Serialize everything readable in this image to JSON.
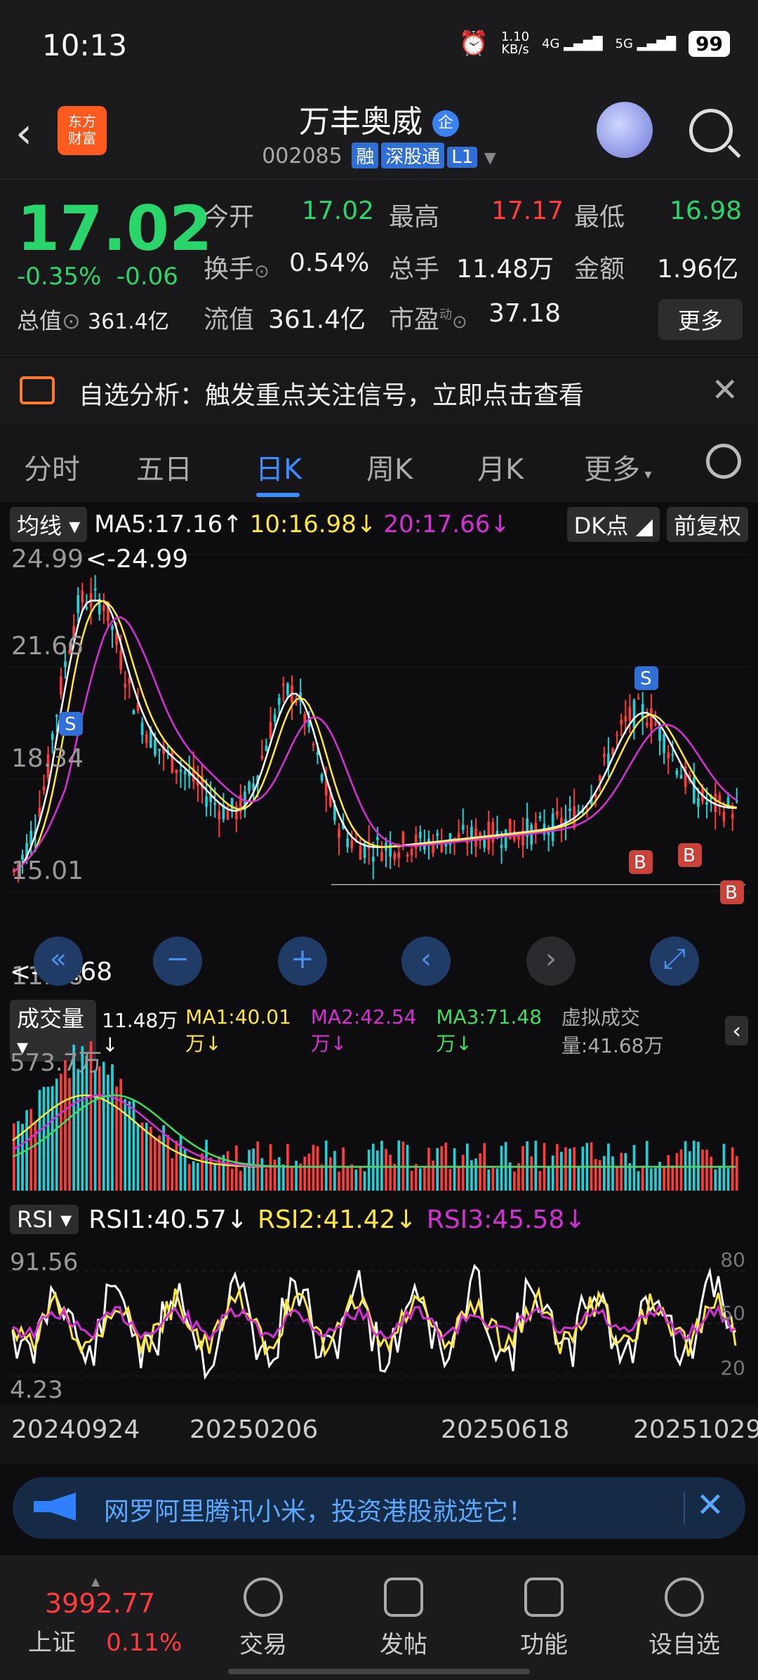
{
  "status": {
    "time": "10:13",
    "net_speed": "1.10",
    "net_unit": "KB/s",
    "sig1": "4G",
    "sig2": "5G",
    "battery": "99"
  },
  "header": {
    "logo_line1": "东方",
    "logo_line2": "财富",
    "title": "万丰奥威",
    "title_badge": "企",
    "code": "002085",
    "tags": [
      "融",
      "深股通",
      "L1"
    ]
  },
  "quote": {
    "price": "17.02",
    "change_pct": "-0.35%",
    "change": "-0.06",
    "zongzhi_label": "总值",
    "zongzhi": "361.4亿",
    "open_label": "今开",
    "open": "17.02",
    "high_label": "最高",
    "high": "17.17",
    "low_label": "最低",
    "low": "16.98",
    "turnover_label": "换手",
    "turnover": "0.54%",
    "volume_label": "总手",
    "volume": "11.48万",
    "amount_label": "金额",
    "amount": "1.96亿",
    "float_label": "流值",
    "float": "361.4亿",
    "pe_label": "市盈",
    "pe_sup": "动",
    "pe": "37.18",
    "more": "更多"
  },
  "notice": {
    "text": "自选分析：触发重点关注信号，立即点击查看"
  },
  "tabs": [
    "分时",
    "五日",
    "日K",
    "周K",
    "月K",
    "更多"
  ],
  "active_tab": "日K",
  "kline": {
    "indicator": "均线",
    "ma5": "MA5:17.16",
    "ma10": "10:16.98",
    "ma20": "20:17.66",
    "dk": "DK点",
    "fq": "前复权",
    "y_labels": [
      "24.99",
      "21.66",
      "18.34",
      "15.01",
      "11.68"
    ],
    "max_mark": "<-24.99",
    "min_mark": "<-11.68",
    "s_marker": "S",
    "b_marker": "B",
    "colors": {
      "up": "#ff3b3b",
      "down": "#21d1d8",
      "ma5": "#ffffff",
      "ma10": "#ffe63b",
      "ma20": "#d62fd6"
    }
  },
  "volume": {
    "indicator": "成交量",
    "vol": "11.48万",
    "ma1": "MA1:40.01万",
    "ma2": "MA2:42.54万",
    "ma3": "MA3:71.48万",
    "virtual": "虚拟成交量:41.68万",
    "y_label": "573.7万"
  },
  "rsi": {
    "indicator": "RSI",
    "rsi1": "RSI1:40.57",
    "rsi2": "RSI2:41.42",
    "rsi3": "RSI3:45.58",
    "y_top": "91.56",
    "y_bottom": "4.23",
    "r80": "80",
    "r50": "50",
    "r20": "20"
  },
  "dates": [
    "20240924",
    "20250206",
    "20250618",
    "20251029"
  ],
  "ad": {
    "text": "网罗阿里腾讯小米，投资港股就选它！"
  },
  "bottom": {
    "index_value": "3992.77",
    "index_name": "上证",
    "index_change": "0.11%",
    "items": [
      "交易",
      "发帖",
      "功能",
      "设自选"
    ]
  }
}
